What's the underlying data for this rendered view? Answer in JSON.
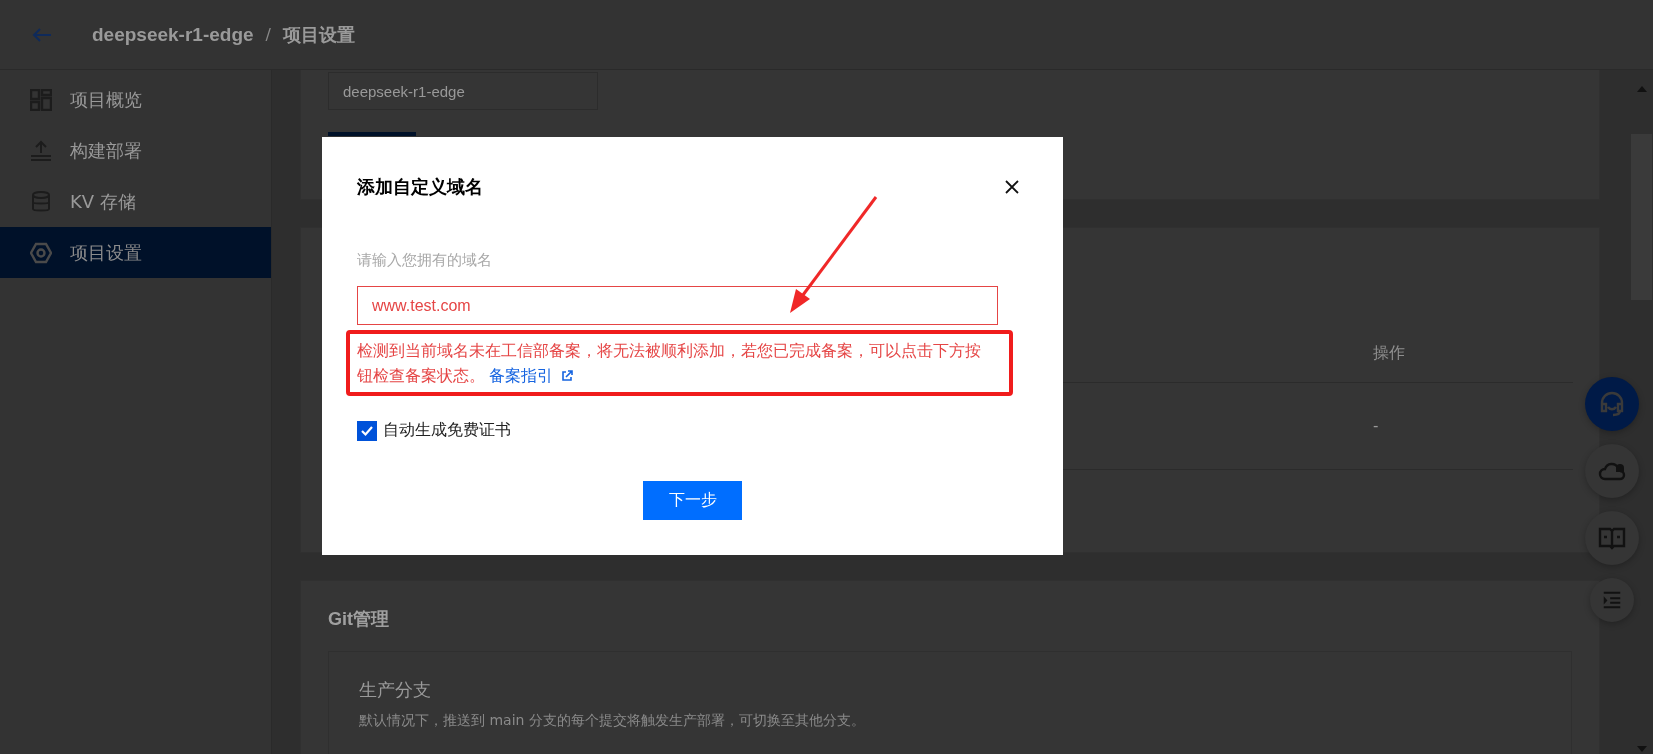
{
  "header": {
    "project": "deepseek-r1-edge",
    "separator": "/",
    "page": "项目设置"
  },
  "sidebar": {
    "items": [
      {
        "label": "项目概览",
        "selected": false
      },
      {
        "label": "构建部署",
        "selected": false
      },
      {
        "label": "KV 存储",
        "selected": false
      },
      {
        "label": "项目设置",
        "selected": true
      }
    ]
  },
  "project_card": {
    "name_field": "deepseek-r1-edge"
  },
  "domain_table": {
    "column_header": "操作",
    "rows": [
      {
        "action": "-"
      }
    ]
  },
  "git_section": {
    "title": "Git管理",
    "branch_title": "生产分支",
    "branch_description": "默认情况下，推送到 main 分支的每个提交将触发生产部署，可切换至其他分支。"
  },
  "dialog": {
    "title": "添加自定义域名",
    "field_label": "请输入您拥有的域名",
    "domain_input": {
      "value": "www.test.com",
      "error": true
    },
    "error_message": "检测到当前域名未在工信部备案，将无法被顺利添加，若您已完成备案，可以点击下方按钮检查备案状态。",
    "guide_link": "备案指引",
    "auto_certificate": {
      "label": "自动生成免费证书",
      "checked": true
    },
    "next_button": "下一步"
  }
}
